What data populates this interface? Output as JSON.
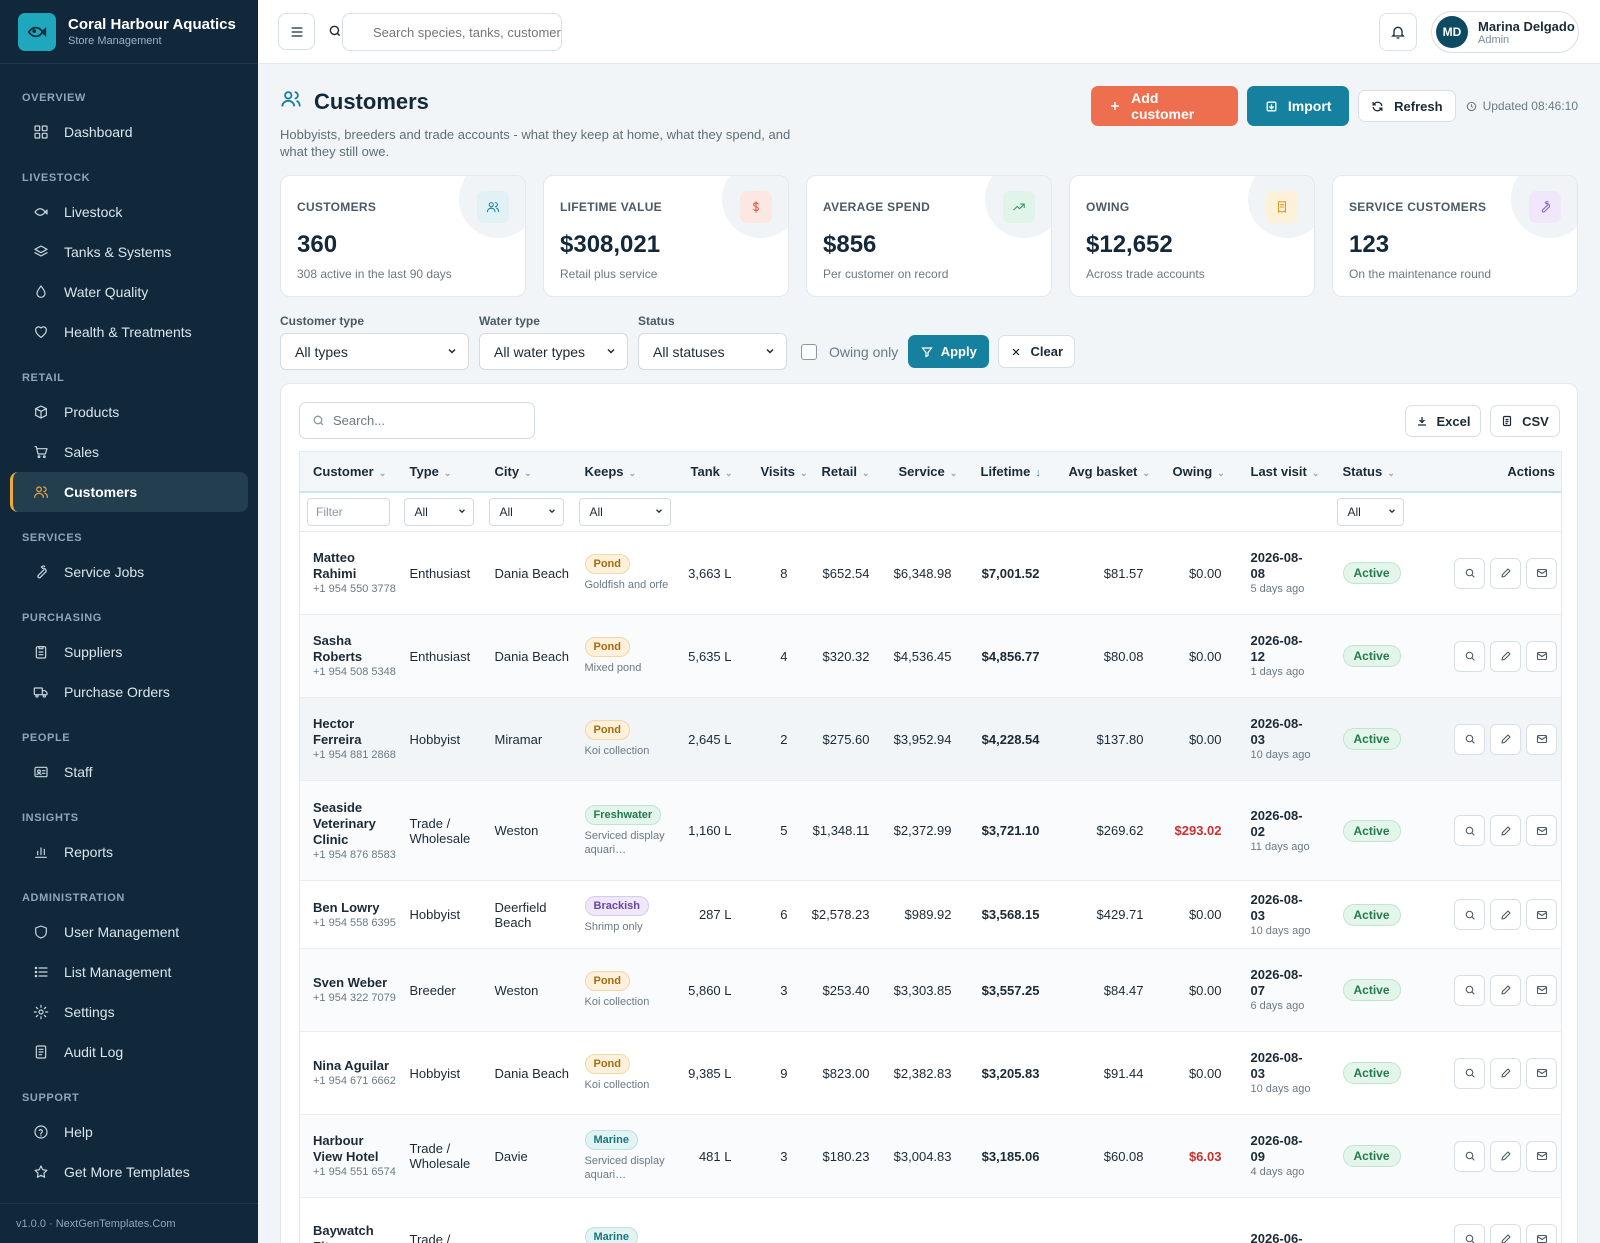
{
  "brand": {
    "name": "Coral Harbour Aquatics",
    "subtitle": "Store Management"
  },
  "sidebar": {
    "sections": [
      {
        "title": "OVERVIEW",
        "items": [
          {
            "label": "Dashboard",
            "icon": "dashboard-icon"
          }
        ]
      },
      {
        "title": "LIVESTOCK",
        "items": [
          {
            "label": "Livestock",
            "icon": "fish-icon"
          },
          {
            "label": "Tanks & Systems",
            "icon": "layers-icon"
          },
          {
            "label": "Water Quality",
            "icon": "droplet-icon"
          },
          {
            "label": "Health & Treatments",
            "icon": "heart-icon"
          }
        ]
      },
      {
        "title": "RETAIL",
        "items": [
          {
            "label": "Products",
            "icon": "box-icon"
          },
          {
            "label": "Sales",
            "icon": "cart-icon"
          },
          {
            "label": "Customers",
            "icon": "users-icon",
            "active": true
          }
        ]
      },
      {
        "title": "SERVICES",
        "items": [
          {
            "label": "Service Jobs",
            "icon": "wrench-icon"
          }
        ]
      },
      {
        "title": "PURCHASING",
        "items": [
          {
            "label": "Suppliers",
            "icon": "clipboard-icon"
          },
          {
            "label": "Purchase Orders",
            "icon": "truck-icon"
          }
        ]
      },
      {
        "title": "PEOPLE",
        "items": [
          {
            "label": "Staff",
            "icon": "id-card-icon"
          }
        ]
      },
      {
        "title": "INSIGHTS",
        "items": [
          {
            "label": "Reports",
            "icon": "bar-chart-icon"
          }
        ]
      },
      {
        "title": "ADMINISTRATION",
        "items": [
          {
            "label": "User Management",
            "icon": "shield-icon"
          },
          {
            "label": "List Management",
            "icon": "list-icon"
          },
          {
            "label": "Settings",
            "icon": "gear-icon"
          },
          {
            "label": "Audit Log",
            "icon": "log-icon"
          }
        ]
      },
      {
        "title": "SUPPORT",
        "items": [
          {
            "label": "Help",
            "icon": "help-icon"
          },
          {
            "label": "Get More Templates",
            "icon": "star-icon"
          }
        ]
      }
    ],
    "footer": "v1.0.0 · NextGenTemplates.Com"
  },
  "topbar": {
    "search_placeholder": "Search species, tanks, customers…",
    "user": {
      "initials": "MD",
      "name": "Marina Delgado",
      "role": "Admin"
    }
  },
  "page": {
    "title": "Customers",
    "subtitle": "Hobbyists, breeders and trade accounts - what they keep at home, what they spend, and what they still owe.",
    "actions": {
      "add": "Add customer",
      "import": "Import",
      "refresh": "Refresh"
    },
    "updated": "Updated 08:46:10"
  },
  "kpis": [
    {
      "label": "CUSTOMERS",
      "value": "360",
      "note": "308 active in the last 90 days",
      "icon": "users-icon",
      "color": "#16809f",
      "bg": "#e2f1f5"
    },
    {
      "label": "LIFETIME VALUE",
      "value": "$308,021",
      "note": "Retail plus service",
      "icon": "dollar-icon",
      "color": "#e2543a",
      "bg": "#fde7e2"
    },
    {
      "label": "AVERAGE SPEND",
      "value": "$856",
      "note": "Per customer on record",
      "icon": "trend-up-icon",
      "color": "#2f9a5f",
      "bg": "#e1f4e9"
    },
    {
      "label": "OWING",
      "value": "$12,652",
      "note": "Across trade accounts",
      "icon": "receipt-icon",
      "color": "#d39a1f",
      "bg": "#fdf1d9"
    },
    {
      "label": "SERVICE CUSTOMERS",
      "value": "123",
      "note": "On the maintenance round",
      "icon": "wrench-icon",
      "color": "#8b5cc7",
      "bg": "#f0e8fa"
    }
  ],
  "filters": {
    "customer_type": {
      "label": "Customer type",
      "value": "All types"
    },
    "water_type": {
      "label": "Water type",
      "value": "All water types"
    },
    "status": {
      "label": "Status",
      "value": "All statuses"
    },
    "owing_only": "Owing only",
    "apply": "Apply",
    "clear": "Clear"
  },
  "table": {
    "search_placeholder": "Search...",
    "export_excel": "Excel",
    "export_csv": "CSV",
    "columns": [
      "Customer",
      "Type",
      "City",
      "Keeps",
      "Tank",
      "Visits",
      "Retail",
      "Service",
      "Lifetime",
      "Avg basket",
      "Owing",
      "Last visit",
      "Status",
      "Actions"
    ],
    "column_filters": {
      "customer": "Filter",
      "type": "All",
      "city": "All",
      "keeps": "All",
      "status": "All"
    },
    "rows": [
      {
        "name": "Matteo Rahimi",
        "phone": "+1 954 550 3778",
        "type": "Enthusiast",
        "city": "Dania Beach",
        "keeps": "Pond",
        "keeps_kind": "pond",
        "keeps_note": "Goldfish and orfe",
        "tank": "3,663 L",
        "visits": "8",
        "retail": "$652.54",
        "service": "$6,348.98",
        "lifetime": "$7,001.52",
        "avg": "$81.57",
        "owing": "$0.00",
        "owing_red": false,
        "last": "2026-08-08",
        "ago": "5 days ago",
        "status": "Active"
      },
      {
        "name": "Sasha Roberts",
        "phone": "+1 954 508 5348",
        "type": "Enthusiast",
        "city": "Dania Beach",
        "keeps": "Pond",
        "keeps_kind": "pond",
        "keeps_note": "Mixed pond",
        "tank": "5,635 L",
        "visits": "4",
        "retail": "$320.32",
        "service": "$4,536.45",
        "lifetime": "$4,856.77",
        "avg": "$80.08",
        "owing": "$0.00",
        "owing_red": false,
        "last": "2026-08-12",
        "ago": "1 days ago",
        "status": "Active"
      },
      {
        "name": "Hector Ferreira",
        "phone": "+1 954 881 2868",
        "type": "Hobbyist",
        "city": "Miramar",
        "keeps": "Pond",
        "keeps_kind": "pond",
        "keeps_note": "Koi collection",
        "tank": "2,645 L",
        "visits": "2",
        "retail": "$275.60",
        "service": "$3,952.94",
        "lifetime": "$4,228.54",
        "avg": "$137.80",
        "owing": "$0.00",
        "owing_red": false,
        "last": "2026-08-03",
        "ago": "10 days ago",
        "status": "Active"
      },
      {
        "name": "Seaside Veterinary Clinic",
        "phone": "+1 954 876 8583",
        "type": "Trade / Wholesale",
        "city": "Weston",
        "keeps": "Freshwater",
        "keeps_kind": "fresh",
        "keeps_note": "Serviced display aquari…",
        "tank": "1,160 L",
        "visits": "5",
        "retail": "$1,348.11",
        "service": "$2,372.99",
        "lifetime": "$3,721.10",
        "avg": "$269.62",
        "owing": "$293.02",
        "owing_red": true,
        "last": "2026-08-02",
        "ago": "11 days ago",
        "status": "Active"
      },
      {
        "name": "Ben Lowry",
        "phone": "+1 954 558 6395",
        "type": "Hobbyist",
        "city": "Deerfield Beach",
        "keeps": "Brackish",
        "keeps_kind": "brack",
        "keeps_note": "Shrimp only",
        "tank": "287 L",
        "visits": "6",
        "retail": "$2,578.23",
        "service": "$989.92",
        "lifetime": "$3,568.15",
        "avg": "$429.71",
        "owing": "$0.00",
        "owing_red": false,
        "last": "2026-08-03",
        "ago": "10 days ago",
        "status": "Active"
      },
      {
        "name": "Sven Weber",
        "phone": "+1 954 322 7079",
        "type": "Breeder",
        "city": "Weston",
        "keeps": "Pond",
        "keeps_kind": "pond",
        "keeps_note": "Koi collection",
        "tank": "5,860 L",
        "visits": "3",
        "retail": "$253.40",
        "service": "$3,303.85",
        "lifetime": "$3,557.25",
        "avg": "$84.47",
        "owing": "$0.00",
        "owing_red": false,
        "last": "2026-08-07",
        "ago": "6 days ago",
        "status": "Active"
      },
      {
        "name": "Nina Aguilar",
        "phone": "+1 954 671 6662",
        "type": "Hobbyist",
        "city": "Dania Beach",
        "keeps": "Pond",
        "keeps_kind": "pond",
        "keeps_note": "Koi collection",
        "tank": "9,385 L",
        "visits": "9",
        "retail": "$823.00",
        "service": "$2,382.83",
        "lifetime": "$3,205.83",
        "avg": "$91.44",
        "owing": "$0.00",
        "owing_red": false,
        "last": "2026-08-03",
        "ago": "10 days ago",
        "status": "Active"
      },
      {
        "name": "Harbour View Hotel",
        "phone": "+1 954 551 6574",
        "type": "Trade / Wholesale",
        "city": "Davie",
        "keeps": "Marine",
        "keeps_kind": "marine",
        "keeps_note": "Serviced display aquari…",
        "tank": "481 L",
        "visits": "3",
        "retail": "$180.23",
        "service": "$3,004.83",
        "lifetime": "$3,185.06",
        "avg": "$60.08",
        "owing": "$6.03",
        "owing_red": true,
        "last": "2026-08-09",
        "ago": "4 days ago",
        "status": "Active"
      },
      {
        "name": "Baywatch Fitness",
        "phone": "",
        "type": "Trade /",
        "city": "",
        "keeps": "Marine",
        "keeps_kind": "marine",
        "keeps_note": "",
        "tank": "",
        "visits": "",
        "retail": "",
        "service": "",
        "lifetime": "",
        "avg": "",
        "owing": "",
        "owing_red": false,
        "last": "2026-06-",
        "ago": "",
        "status": ""
      }
    ]
  }
}
